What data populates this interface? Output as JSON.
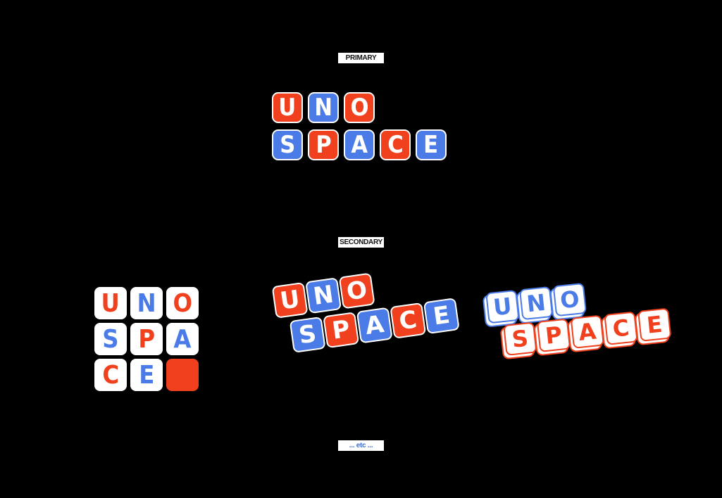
{
  "labels": {
    "primary": "PRIMARY",
    "secondary": "SECONDARY",
    "etc": "... etc ..."
  },
  "colors": {
    "red": "#f0401e",
    "blue": "#4a7be6",
    "white": "#ffffff",
    "background": "#000000"
  },
  "primary_logo": {
    "line1": [
      "U",
      "N",
      "O"
    ],
    "line2": [
      "S",
      "P",
      "A",
      "C",
      "E"
    ]
  },
  "grid_logo": {
    "row1": [
      "U",
      "N",
      "O"
    ],
    "row2": [
      "S",
      "P",
      "A"
    ],
    "row3": [
      "C",
      "E"
    ]
  },
  "tilted_logo": {
    "line1": [
      "U",
      "N",
      "O"
    ],
    "line2": [
      "S",
      "P",
      "A",
      "C",
      "E"
    ]
  },
  "outline_logo": {
    "line1": [
      "U",
      "N",
      "O"
    ],
    "line2": [
      "S",
      "P",
      "A",
      "C",
      "E"
    ]
  }
}
